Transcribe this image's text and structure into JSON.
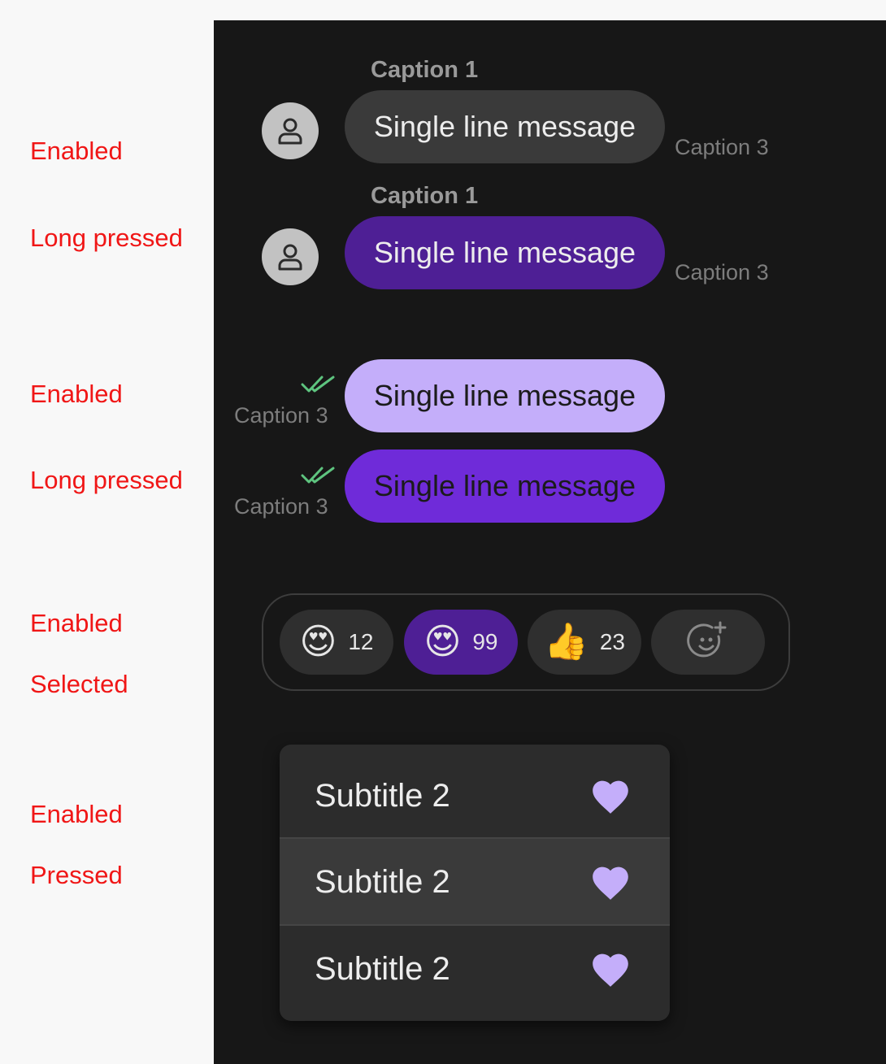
{
  "state_labels": {
    "incoming_enabled": "Enabled",
    "incoming_long_pressed": "Long pressed",
    "outgoing_enabled": "Enabled",
    "outgoing_long_pressed": "Long pressed",
    "reactions_enabled": "Enabled",
    "reactions_selected": "Selected",
    "menu_enabled": "Enabled",
    "menu_pressed": "Pressed"
  },
  "incoming": [
    {
      "caption1": "Caption 1",
      "message": "Single line message",
      "caption3": "Caption 3",
      "state": "enabled",
      "bubble_color": "#3a3a3a",
      "text_color": "#ededed",
      "avatar_icon": "person-icon"
    },
    {
      "caption1": "Caption 1",
      "message": "Single line message",
      "caption3": "Caption 3",
      "state": "long-pressed",
      "bubble_color": "#4e1f95",
      "text_color": "#ededed",
      "avatar_icon": "person-icon"
    }
  ],
  "outgoing": [
    {
      "message": "Single line message",
      "caption3": "Caption 3",
      "state": "enabled",
      "bubble_color": "#c4aefa",
      "text_color": "#1b1b1b",
      "status_icon": "double-check-icon",
      "status_color": "#5ec47f"
    },
    {
      "message": "Single line message",
      "caption3": "Caption 3",
      "state": "long-pressed",
      "bubble_color": "#6f2bd9",
      "text_color": "#1b1b1b",
      "status_icon": "double-check-icon",
      "status_color": "#5ec47f"
    }
  ],
  "reactions": [
    {
      "emoji": "😍",
      "emoji_name": "heart-eyes-emoji",
      "count": "12",
      "selected": false
    },
    {
      "emoji": "😍",
      "emoji_name": "heart-eyes-emoji",
      "count": "99",
      "selected": true
    },
    {
      "emoji": "👍",
      "emoji_name": "thumbs-up-emoji",
      "count": "23",
      "selected": false
    },
    {
      "icon": "add-reaction-icon",
      "selected": false
    }
  ],
  "menu": {
    "items": [
      {
        "label": "Subtitle 2",
        "icon": "heart-icon",
        "state": "enabled"
      },
      {
        "label": "Subtitle 2",
        "icon": "heart-icon",
        "state": "pressed"
      },
      {
        "label": "Subtitle 2",
        "icon": "heart-icon",
        "state": "enabled"
      }
    ],
    "icon_color": "#c4aefa"
  },
  "colors": {
    "panel_background": "#171717",
    "state_label": "#f01616",
    "accent_selected": "#4e1f95"
  }
}
